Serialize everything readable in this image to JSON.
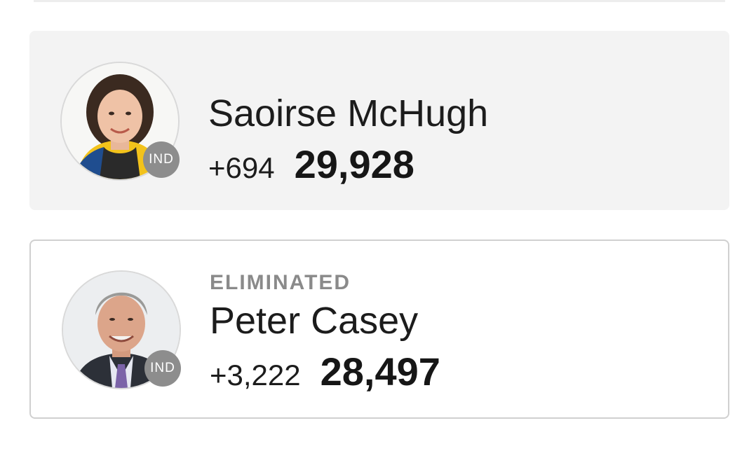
{
  "candidates": [
    {
      "name": "Saoirse McHugh",
      "party": "IND",
      "status": "",
      "vote_change": "+694",
      "vote_total": "29,928"
    },
    {
      "name": "Peter Casey",
      "party": "IND",
      "status": "ELIMINATED",
      "vote_change": "+3,222",
      "vote_total": "28,497"
    }
  ],
  "colors": {
    "highlight_card_bg": "#f3f3f3",
    "badge_bg": "#8d8d8d",
    "status_text": "#8a8a8a"
  }
}
